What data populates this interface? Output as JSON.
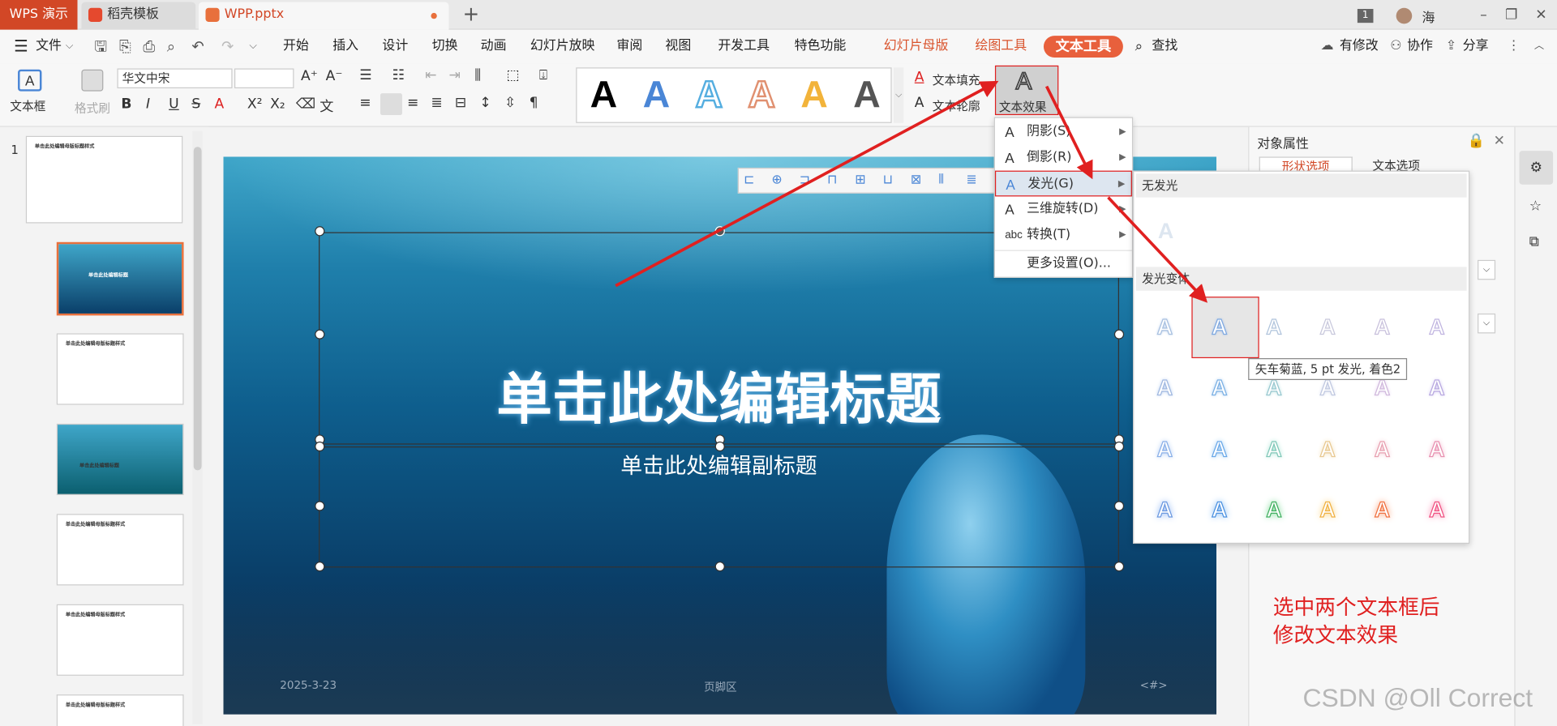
{
  "titlebar": {
    "app_tab": "WPS 演示",
    "tabs": [
      {
        "label": "稻壳模板"
      },
      {
        "label": "WPP.pptx"
      }
    ],
    "new_tab": "+",
    "badge": "1",
    "user": "海"
  },
  "menubar": {
    "file": "文件",
    "items": [
      "开始",
      "插入",
      "设计",
      "切换",
      "动画",
      "幻灯片放映",
      "审阅",
      "视图",
      "开发工具",
      "特色功能"
    ],
    "context_tabs": [
      "幻灯片母版",
      "绘图工具"
    ],
    "active_tab": "文本工具",
    "search": "查找",
    "right": [
      "有修改",
      "协作",
      "分享"
    ]
  },
  "ribbon": {
    "textbox": "文本框",
    "format_painter": "格式刷",
    "font": "华文中宋",
    "size": "",
    "text_fill": "文本填充",
    "text_outline": "文本轮廓",
    "text_effect": "文本效果",
    "gallery_letter": "A"
  },
  "thumbs": {
    "number": "1",
    "master_title": "单击此处编辑母版标题样式",
    "slide_title": "单击此处编辑标题"
  },
  "slide": {
    "title": "单击此处编辑标题",
    "subtitle": "单击此处编辑副标题",
    "date": "2025-3-23",
    "footer": "页脚区",
    "number": "<#>"
  },
  "effect_menu": {
    "items": [
      {
        "label": "阴影(S)"
      },
      {
        "label": "倒影(R)"
      },
      {
        "label": "发光(G)"
      },
      {
        "label": "三维旋转(D)"
      },
      {
        "label": "转换(T)"
      },
      {
        "label": "更多设置(O)..."
      }
    ],
    "icon_abc": "abc"
  },
  "glow_panel": {
    "no_glow": "无发光",
    "variants": "发光变体",
    "tooltip": "矢车菊蓝, 5 pt 发光, 着色2"
  },
  "right_panel": {
    "title": "对象属性",
    "tab1": "形状选项",
    "tab2": "文本选项"
  },
  "annotation": {
    "line1": "选中两个文本框后",
    "line2": "修改文本效果"
  },
  "watermark": "CSDN @Oll Correct",
  "colors": {
    "accent": "#d24726",
    "active_tab": "#e8603c",
    "arrow": "#e02020"
  }
}
